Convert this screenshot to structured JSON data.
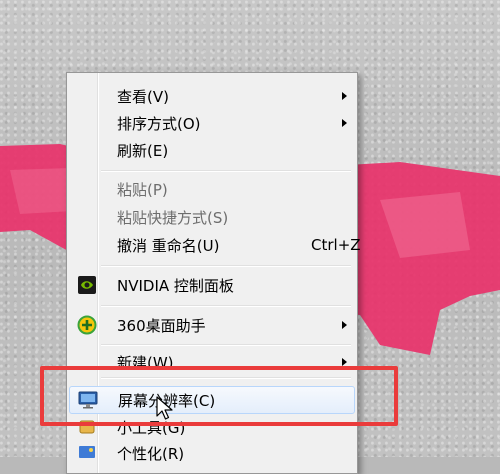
{
  "context_menu": {
    "items": [
      {
        "label": "查看(V)",
        "shortcut": "",
        "submenu": true,
        "disabled": false
      },
      {
        "label": "排序方式(O)",
        "shortcut": "",
        "submenu": true,
        "disabled": false
      },
      {
        "label": "刷新(E)",
        "shortcut": "",
        "submenu": false,
        "disabled": false
      },
      {
        "label": "粘贴(P)",
        "shortcut": "",
        "submenu": false,
        "disabled": true
      },
      {
        "label": "粘贴快捷方式(S)",
        "shortcut": "",
        "submenu": false,
        "disabled": true
      },
      {
        "label": "撤消 重命名(U)",
        "shortcut": "Ctrl+Z",
        "submenu": false,
        "disabled": false
      },
      {
        "label": "NVIDIA 控制面板",
        "shortcut": "",
        "submenu": false,
        "disabled": false,
        "icon": "nvidia-icon"
      },
      {
        "label": "360桌面助手",
        "shortcut": "",
        "submenu": true,
        "disabled": false,
        "icon": "360-assistant-icon"
      },
      {
        "label": "新建(W)",
        "shortcut": "",
        "submenu": true,
        "disabled": false
      },
      {
        "label": "屏幕分辨率(C)",
        "shortcut": "",
        "submenu": false,
        "disabled": false,
        "icon": "monitor-icon",
        "highlighted": true
      },
      {
        "label": "小工具(G)",
        "shortcut": "",
        "submenu": false,
        "disabled": false,
        "icon": "gadget-icon"
      },
      {
        "label": "个性化(R)",
        "shortcut": "",
        "submenu": false,
        "disabled": false,
        "icon": "personalize-icon"
      }
    ]
  },
  "colors": {
    "highlight_box": "#ea3b3b",
    "pink_shape": "#e8326a"
  }
}
